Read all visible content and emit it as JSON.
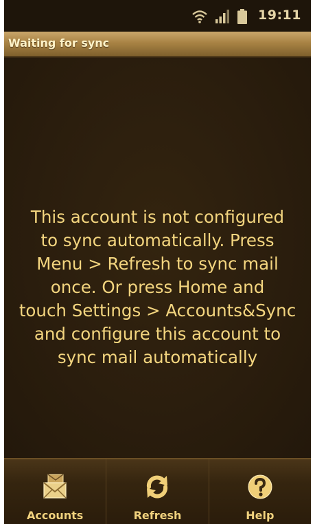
{
  "status_bar": {
    "time": "19:11",
    "icons": [
      "wifi-icon",
      "signal-icon",
      "battery-icon"
    ]
  },
  "title_bar": {
    "title": "Waiting for sync"
  },
  "main": {
    "message_lines": [
      "This account is not configured",
      "to sync automatically. Press",
      "Menu > Refresh to sync mail",
      "once. Or press Home and",
      "touch Settings > Accounts&Sync",
      "and configure this account to",
      "sync mail automatically"
    ]
  },
  "menu": {
    "items": [
      {
        "label": "Accounts",
        "icon": "accounts-icon"
      },
      {
        "label": "Refresh",
        "icon": "refresh-icon"
      },
      {
        "label": "Help",
        "icon": "help-icon"
      }
    ]
  },
  "colors": {
    "background": "#2a1d0f",
    "text": "#f3d57f",
    "title_bar": "#a88344"
  }
}
